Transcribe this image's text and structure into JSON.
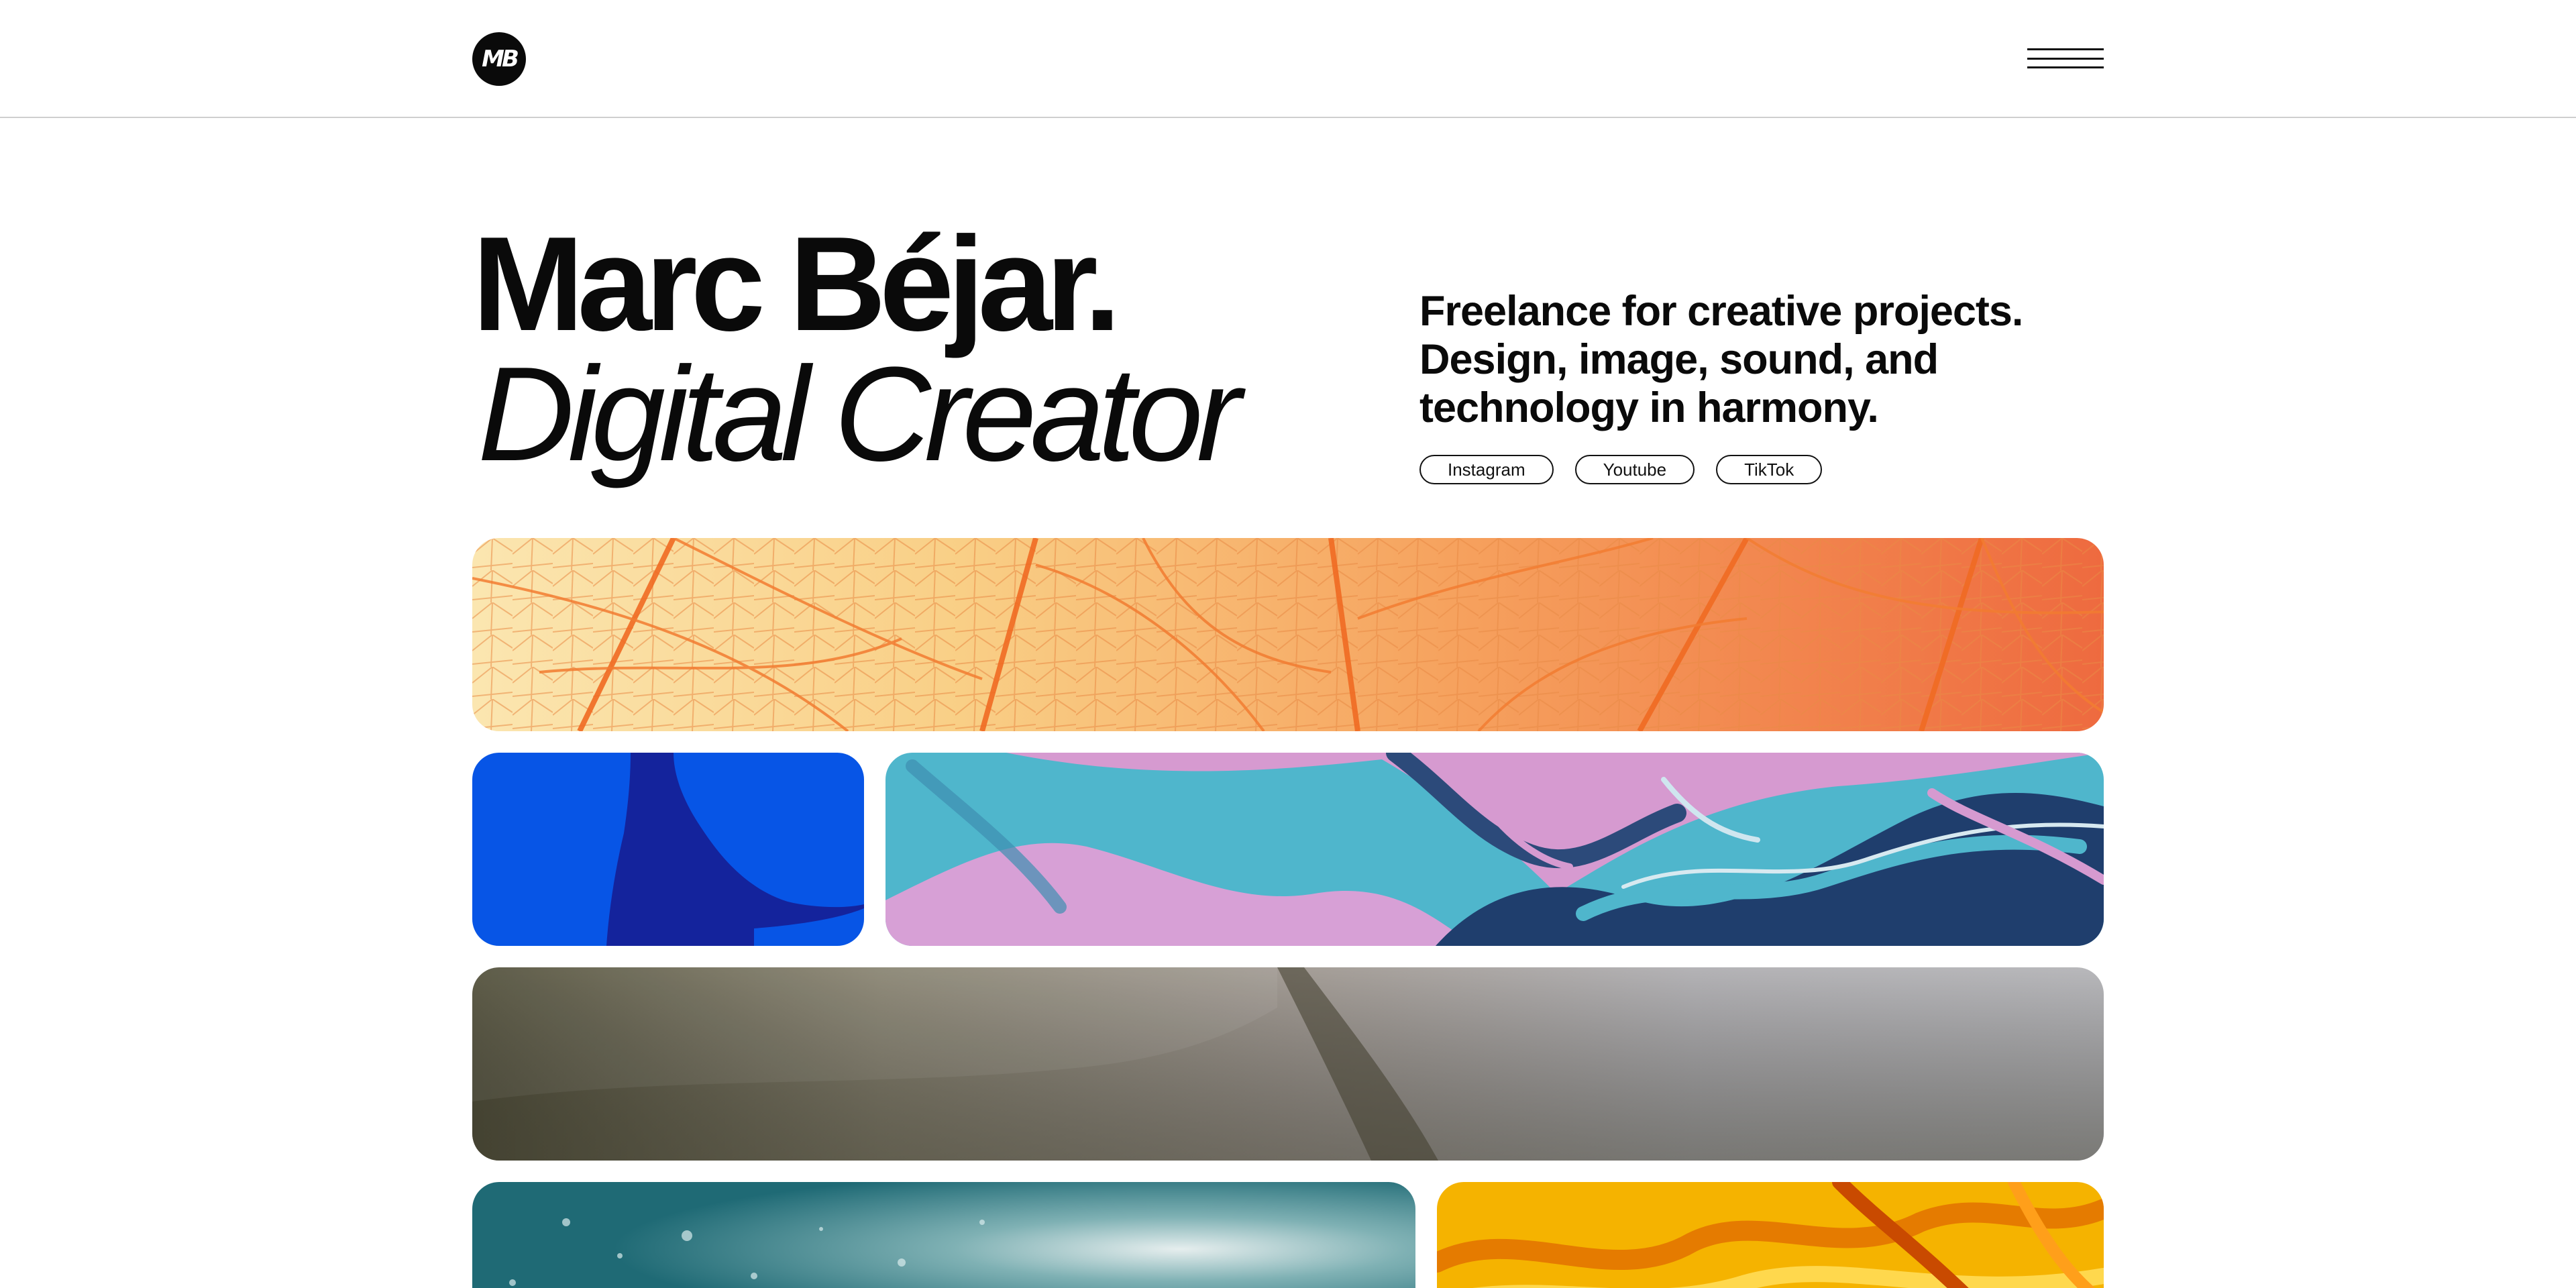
{
  "header": {
    "logo_text": "MB",
    "logo_icon": "mb-monogram-logo",
    "menu_icon": "hamburger-menu-icon"
  },
  "hero": {
    "name": "Marc Béjar.",
    "role": "Digital Creator",
    "tagline": "Freelance for creative projects. Design, image, sound, and technology in harmony."
  },
  "socials": [
    {
      "label": "Instagram"
    },
    {
      "label": "Youtube"
    },
    {
      "label": "TikTok"
    }
  ],
  "gallery": [
    {
      "subject": "orange leaf veins macro",
      "accent": "#f2752e"
    },
    {
      "subject": "figure silhouette on blue",
      "accent": "#0755e6"
    },
    {
      "subject": "pink and teal marbled paint",
      "accent": "#4fb6cc"
    },
    {
      "subject": "olive and grey fabric texture",
      "accent": "#8c8a80"
    },
    {
      "subject": "teal water droplets",
      "accent": "#2b7c85"
    },
    {
      "subject": "yellow orange liquid swirl",
      "accent": "#f5b300"
    }
  ],
  "colors": {
    "text": "#0a0a0a",
    "background": "#ffffff",
    "divider": "#cfcfcf"
  }
}
